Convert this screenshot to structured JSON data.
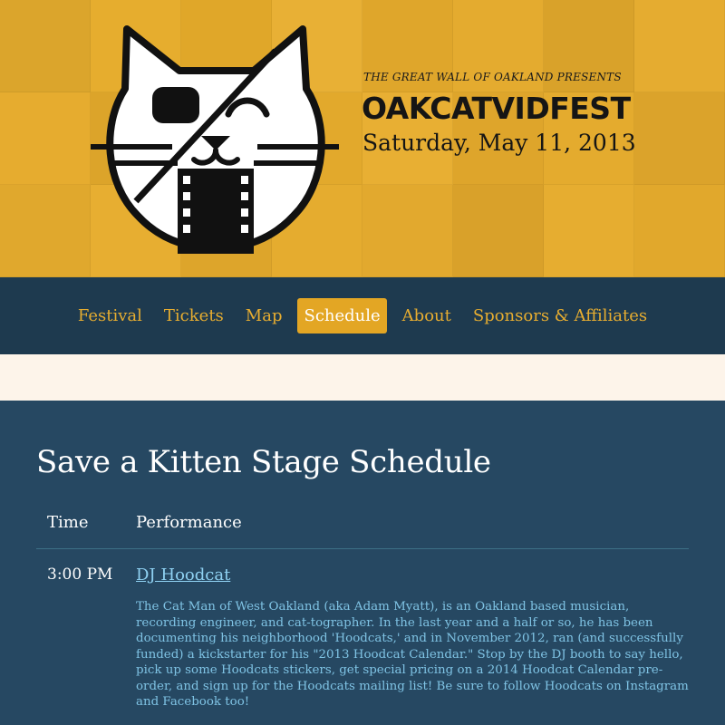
{
  "header": {
    "presents": "THE GREAT WALL OF OAKLAND PRESENTS",
    "wordmark": "OAKCATVIDFEST",
    "date": "Saturday, May 11, 2013",
    "logo_icon": "pirate-cat-film-logo"
  },
  "nav": {
    "items": [
      {
        "label": "Festival"
      },
      {
        "label": "Tickets"
      },
      {
        "label": "Map"
      },
      {
        "label": "Schedule"
      },
      {
        "label": "About"
      },
      {
        "label": "Sponsors & Affiliates"
      }
    ],
    "active_index": 3
  },
  "schedule": {
    "title": "Save a Kitten Stage Schedule",
    "headers": {
      "time": "Time",
      "performance": "Performance"
    },
    "rows": [
      {
        "time": "3:00 PM",
        "performer": "DJ Hoodcat",
        "description": "The Cat Man of West Oakland (aka Adam Myatt), is an Oakland based musician, recording engineer, and cat-tographer. In the last year and a half or so, he has been documenting his neighborhood 'Hoodcats,' and in November 2012, ran (and successfully funded) a kickstarter for his \"2013 Hoodcat Calendar.\" Stop by the DJ booth to say hello, pick up some Hoodcats stickers, get special pricing on a 2014 Hoodcat Calendar pre-order, and sign up for the Hoodcats mailing list! Be sure to follow Hoodcats on Instagram and Facebook too!"
      }
    ]
  },
  "colors": {
    "header_yellow": "#e3aa2b",
    "nav_bg": "#1e3a4f",
    "main_bg": "#264862",
    "cream": "#fdf4ea",
    "link_blue": "#8fd1f2"
  }
}
